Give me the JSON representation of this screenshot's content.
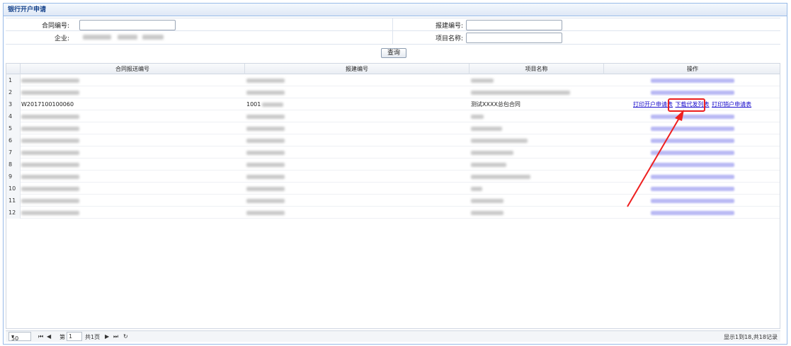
{
  "panel": {
    "title": "银行开户申请"
  },
  "search": {
    "contract_no_label": "合同编号:",
    "contract_no_value": "",
    "report_no_label": "报建编号:",
    "report_no_value": "",
    "company_label": "企业:",
    "project_name_label": "项目名称:",
    "project_name_value": "",
    "query_button": "查询"
  },
  "grid": {
    "columns": [
      "合同报送编号",
      "报建编号",
      "项目名称",
      "操作"
    ],
    "row_numbers": [
      "1",
      "2",
      "3",
      "4",
      "5",
      "6",
      "7",
      "8",
      "9",
      "10",
      "11",
      "12"
    ],
    "visible_row": {
      "contract_report_no": "W2017100100060",
      "report_no_prefix": "1001",
      "project_name": "测试XXXX总包合同",
      "actions": [
        "打印开户申请表",
        "下载代发列表",
        "打印销户申请表"
      ]
    }
  },
  "pager": {
    "page_size": "50",
    "page_label_prefix": "第",
    "page_number": "1",
    "page_total": "共1页",
    "summary": "显示1到18,共18记录"
  },
  "colors": {
    "accent": "#15428b",
    "highlight": "#ee2020",
    "link": "#1a0dcc"
  }
}
